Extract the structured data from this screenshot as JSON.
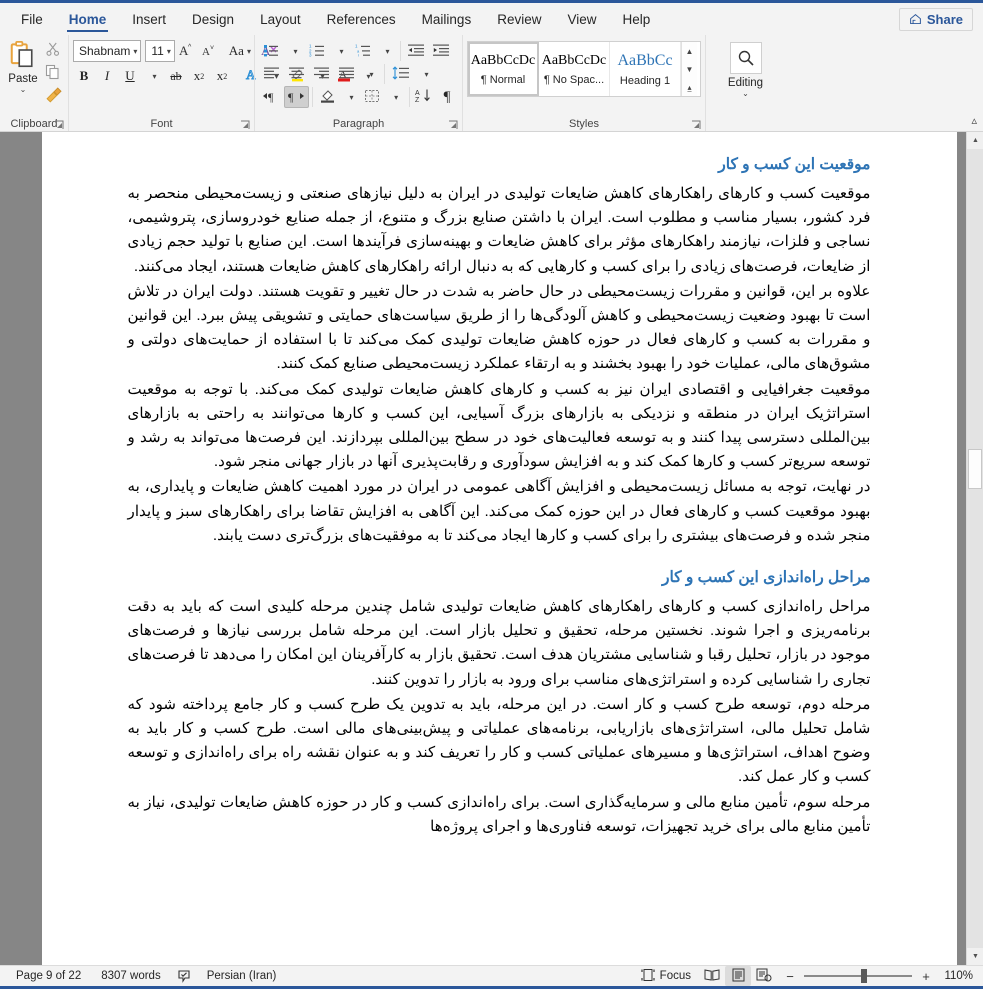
{
  "window": {
    "accent_color": "#2b579a",
    "ribbon_bg": "#f3f3f3"
  },
  "tabs": [
    {
      "label": "File",
      "active": false
    },
    {
      "label": "Home",
      "active": true
    },
    {
      "label": "Insert",
      "active": false
    },
    {
      "label": "Design",
      "active": false
    },
    {
      "label": "Layout",
      "active": false
    },
    {
      "label": "References",
      "active": false
    },
    {
      "label": "Mailings",
      "active": false
    },
    {
      "label": "Review",
      "active": false
    },
    {
      "label": "View",
      "active": false
    },
    {
      "label": "Help",
      "active": false
    }
  ],
  "share": {
    "label": "Share",
    "icon": "share-icon"
  },
  "ribbon": {
    "clipboard": {
      "group_label": "Clipboard",
      "paste_label": "Paste",
      "paste_caret": "⌄",
      "cut_icon": "scissors-icon",
      "copy_icon": "copy-icon",
      "format_painter_icon": "format-painter-icon",
      "launcher_icon": "dialog-launcher-icon"
    },
    "font": {
      "group_label": "Font",
      "font_name": "Shabnam",
      "font_size": "11",
      "grow_font_icon": "grow-font-icon",
      "shrink_font_icon": "shrink-font-icon",
      "change_case_label": "Aa",
      "clear_formatting_icon": "clear-formatting-icon",
      "bold_label": "B",
      "italic_label": "I",
      "underline_label": "U",
      "strikethrough_label": "ab",
      "subscript_label": "x",
      "superscript_label": "x",
      "text_effects_label": "A",
      "highlight_label": "A",
      "font_color_label": "A",
      "launcher_icon": "dialog-launcher-icon"
    },
    "paragraph": {
      "group_label": "Paragraph",
      "bullets_icon": "bullets-icon",
      "numbering_icon": "numbering-icon",
      "multilevel_icon": "multilevel-list-icon",
      "decrease_indent_icon": "decrease-indent-icon",
      "increase_indent_icon": "increase-indent-icon",
      "align_left_icon": "align-left-icon",
      "align_center_icon": "align-center-icon",
      "align_right_icon": "align-right-icon",
      "justify_icon": "justify-icon",
      "line_spacing_icon": "line-spacing-icon",
      "ltr_icon": "left-to-right-icon",
      "rtl_icon": "right-to-left-icon",
      "rtl_active": true,
      "shading_icon": "shading-icon",
      "borders_icon": "borders-icon",
      "sort_icon": "sort-icon",
      "show_marks_label": "¶",
      "launcher_icon": "dialog-launcher-icon"
    },
    "styles": {
      "group_label": "Styles",
      "items": [
        {
          "preview": "AaBbCcDc",
          "name": "¶ Normal",
          "selected": true
        },
        {
          "preview": "AaBbCcDc",
          "name": "¶ No Spac...",
          "selected": false
        },
        {
          "preview": "AaBbCс",
          "name": "Heading 1",
          "selected": false
        }
      ],
      "scroll_up_icon": "chevron-up-icon",
      "scroll_down_icon": "chevron-down-icon",
      "more_icon": "more-styles-icon",
      "launcher_icon": "dialog-launcher-icon"
    },
    "editing": {
      "group_label": "Editing",
      "icon": "search-icon",
      "caret": "⌄"
    },
    "collapse_icon": "collapse-ribbon-icon"
  },
  "document": {
    "sections": [
      {
        "heading": "موقعیت این کسب و کار",
        "paragraphs": [
          "موقعیت کسب و کارهای راهکارهای کاهش ضایعات تولیدی در ایران به دلیل نیازهای صنعتی و زیست‌محیطی منحصر به فرد کشور، بسیار مناسب و مطلوب است. ایران با داشتن صنایع بزرگ و متنوع، از جمله صنایع خودروسازی، پتروشیمی، نساجی و فلزات، نیازمند راهکارهای مؤثر برای کاهش ضایعات و بهینه‌سازی فرآیندها است. این صنایع با تولید حجم زیادی از ضایعات، فرصت‌های زیادی را برای کسب و کارهایی که به دنبال ارائه راهکارهای کاهش ضایعات هستند، ایجاد می‌کنند.",
          "علاوه بر این، قوانین و مقررات زیست‌محیطی در حال حاضر به شدت در حال تغییر و تقویت هستند. دولت ایران در تلاش است تا بهبود وضعیت زیست‌محیطی و کاهش آلودگی‌ها را از طریق سیاست‌های حمایتی و تشویقی پیش ببرد. این قوانین و مقررات به کسب و کارهای فعال در حوزه کاهش ضایعات تولیدی کمک می‌کند تا با استفاده از حمایت‌های دولتی و مشوق‌های مالی، عملیات خود را بهبود بخشند و به ارتقاء عملکرد زیست‌محیطی صنایع کمک کنند.",
          "موقعیت جغرافیایی و اقتصادی ایران نیز به کسب و کارهای کاهش ضایعات تولیدی کمک می‌کند. با توجه به موقعیت استراتژیک ایران در منطقه و نزدیکی به بازارهای بزرگ آسیایی، این کسب و کارها می‌توانند به راحتی به بازارهای بین‌المللی دسترسی پیدا کنند و به توسعه فعالیت‌های خود در سطح بین‌المللی بپردازند. این فرصت‌ها می‌تواند به رشد و توسعه سریع‌تر کسب و کارها کمک کند و به افزایش سودآوری و رقابت‌پذیری آنها در بازار جهانی منجر شود.",
          "در نهایت، توجه به مسائل زیست‌محیطی و افزایش آگاهی عمومی در ایران در مورد اهمیت کاهش ضایعات و پایداری، به بهبود موقعیت کسب و کارهای فعال در این حوزه کمک می‌کند. این آگاهی به افزایش تقاضا برای راهکارهای سبز و پایدار منجر شده و فرصت‌های بیشتری را برای کسب و کارها ایجاد می‌کند تا به موفقیت‌های بزرگ‌تری دست یابند."
        ]
      },
      {
        "heading": "مراحل راه‌اندازی این کسب و کار",
        "paragraphs": [
          "مراحل راه‌اندازی کسب و کارهای راهکارهای کاهش ضایعات تولیدی شامل چندین مرحله کلیدی است که باید به دقت برنامه‌ریزی و اجرا شوند. نخستین مرحله، تحقیق و تحلیل بازار است. این مرحله شامل بررسی نیازها و فرصت‌های موجود در بازار، تحلیل رقبا و شناسایی مشتریان هدف است. تحقیق بازار به کارآفرینان این امکان را می‌دهد تا فرصت‌های تجاری را شناسایی کرده و استراتژی‌های مناسب برای ورود به بازار را تدوین کنند.",
          "مرحله دوم، توسعه طرح کسب و کار است. در این مرحله، باید به تدوین یک طرح کسب و کار جامع پرداخته شود که شامل تحلیل مالی، استراتژی‌های بازاریابی، برنامه‌های عملیاتی و پیش‌بینی‌های مالی است. طرح کسب و کار باید به وضوح اهداف، استراتژی‌ها و مسیرهای عملیاتی کسب و کار را تعریف کند و به عنوان نقشه راه برای راه‌اندازی و توسعه کسب و کار عمل کند.",
          "مرحله سوم، تأمین منابع مالی و سرمایه‌گذاری است. برای راه‌اندازی کسب و کار در حوزه کاهش ضایعات تولیدی، نیاز به تأمین منابع مالی برای خرید تجهیزات، توسعه فناوری‌ها و اجرای پروژه‌ها"
        ]
      }
    ]
  },
  "status": {
    "page_label": "Page 9 of 22",
    "word_count": "8307 words",
    "proofing_icon": "proofing-errors-icon",
    "language": "Persian (Iran)",
    "focus_label": "Focus",
    "focus_icon": "focus-mode-icon",
    "read_mode_icon": "read-mode-icon",
    "print_layout_icon": "print-layout-icon",
    "web_layout_icon": "web-layout-icon",
    "active_view": "print-layout",
    "zoom_out_label": "−",
    "zoom_in_label": "+",
    "zoom_percent": "110%"
  }
}
